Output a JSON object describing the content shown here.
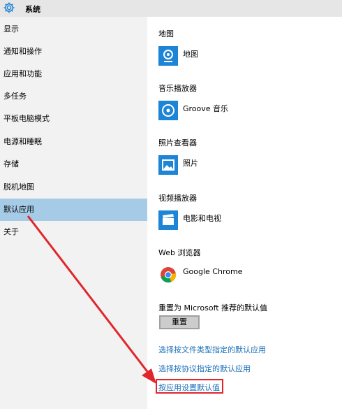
{
  "header": {
    "title": "系统",
    "icon": "gear-icon"
  },
  "sidebar": {
    "items": [
      {
        "label": "显示"
      },
      {
        "label": "通知和操作"
      },
      {
        "label": "应用和功能"
      },
      {
        "label": "多任务"
      },
      {
        "label": "平板电脑模式"
      },
      {
        "label": "电源和睡眠"
      },
      {
        "label": "存储"
      },
      {
        "label": "脱机地图"
      },
      {
        "label": "默认应用",
        "selected": true
      },
      {
        "label": "关于"
      }
    ]
  },
  "main": {
    "sections": [
      {
        "category": "地图",
        "app": "地图",
        "icon": "maps-icon"
      },
      {
        "category": "音乐播放器",
        "app": "Groove 音乐",
        "icon": "groove-music-icon"
      },
      {
        "category": "照片查看器",
        "app": "照片",
        "icon": "photos-icon"
      },
      {
        "category": "视频播放器",
        "app": "电影和电视",
        "icon": "movies-tv-icon"
      },
      {
        "category": "Web 浏览器",
        "app": "Google Chrome",
        "icon": "chrome-icon"
      }
    ],
    "reset": {
      "label": "重置为 Microsoft 推荐的默认值",
      "button": "重置"
    },
    "links": [
      "选择按文件类型指定的默认应用",
      "选择按协议指定的默认应用",
      "按应用设置默认值"
    ]
  },
  "colors": {
    "accent": "#1e85d6",
    "selected": "#a6cbe6",
    "link": "#1b6fb8",
    "annotation": "#e0262b"
  }
}
